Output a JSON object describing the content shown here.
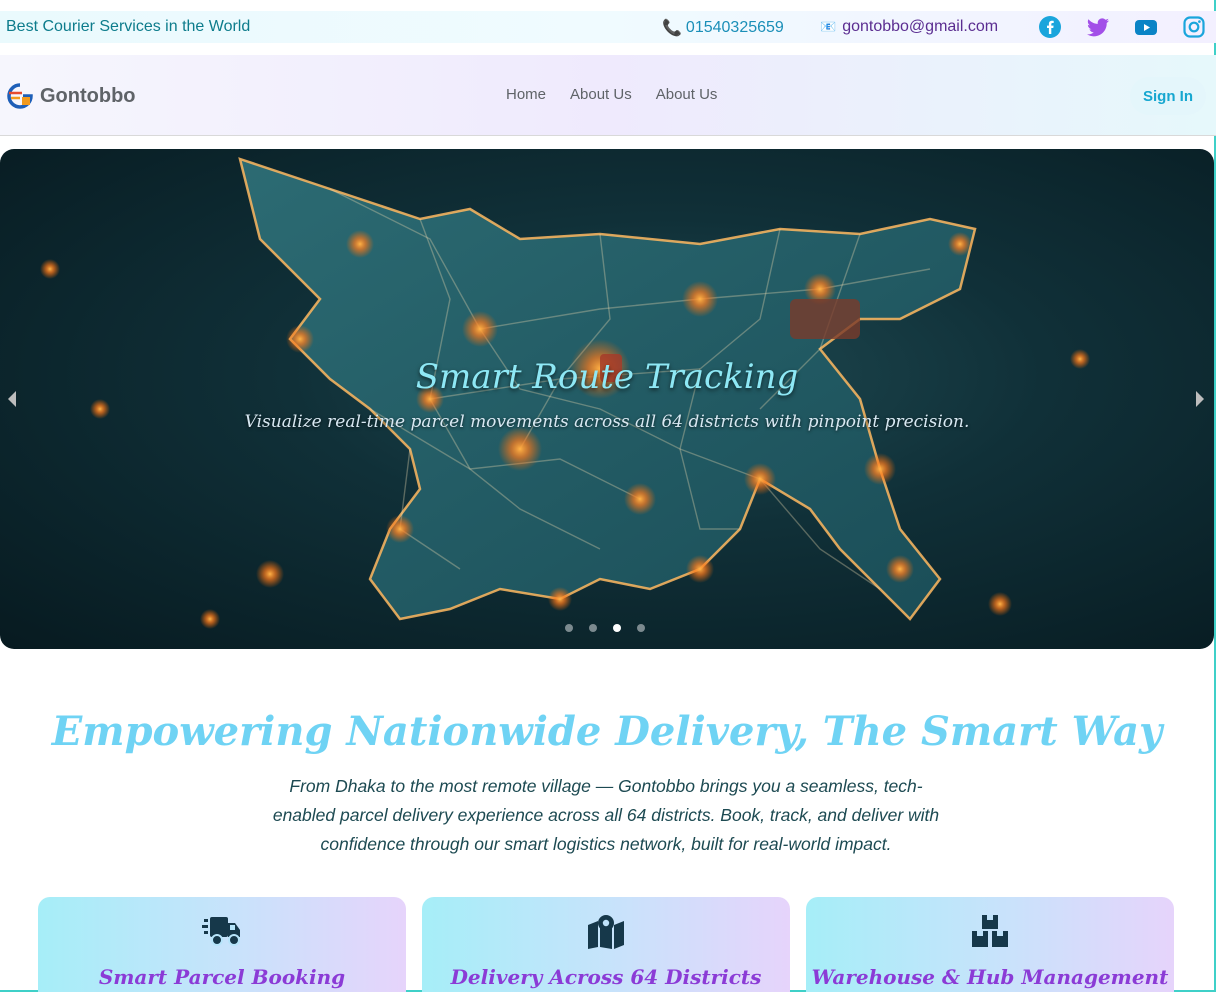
{
  "topbar": {
    "tagline": "Best Courier Services in the World",
    "phone": "01540325659",
    "phone_icon": "📞",
    "email": "gontobbo@gmail.com",
    "email_icon": "📧",
    "social": [
      "facebook-icon",
      "twitter-icon",
      "youtube-icon",
      "instagram-icon"
    ]
  },
  "nav": {
    "brand": "Gontobbo",
    "links": [
      "Home",
      "About Us",
      "About Us"
    ],
    "signin": "Sign In"
  },
  "hero": {
    "title": "Smart Route Tracking",
    "subtitle": "Visualize real-time parcel movements across all 64 districts with pinpoint precision.",
    "slides": 4,
    "active_slide": 3
  },
  "intro": {
    "title": "Empowering Nationwide Delivery, The Smart Way",
    "text": "From Dhaka to the most remote village — Gontobbo brings you a seamless, tech-enabled parcel delivery experience across all 64 districts. Book, track, and deliver with confidence through our smart logistics network, built for real-world impact."
  },
  "cards": [
    {
      "title": "Smart Parcel Booking",
      "icon": "truck-icon"
    },
    {
      "title": "Delivery Across 64 Districts",
      "icon": "map-icon"
    },
    {
      "title": "Warehouse & Hub Management",
      "icon": "boxes-icon"
    }
  ],
  "colors": {
    "accent": "#16a7d0",
    "heading": "#6fd3f4",
    "card_title": "#8b3bd6",
    "facebook": "#1aa5dc",
    "twitter": "#a24fe8",
    "youtube": "#0a84c6",
    "instagram": "#1aa5dc"
  }
}
